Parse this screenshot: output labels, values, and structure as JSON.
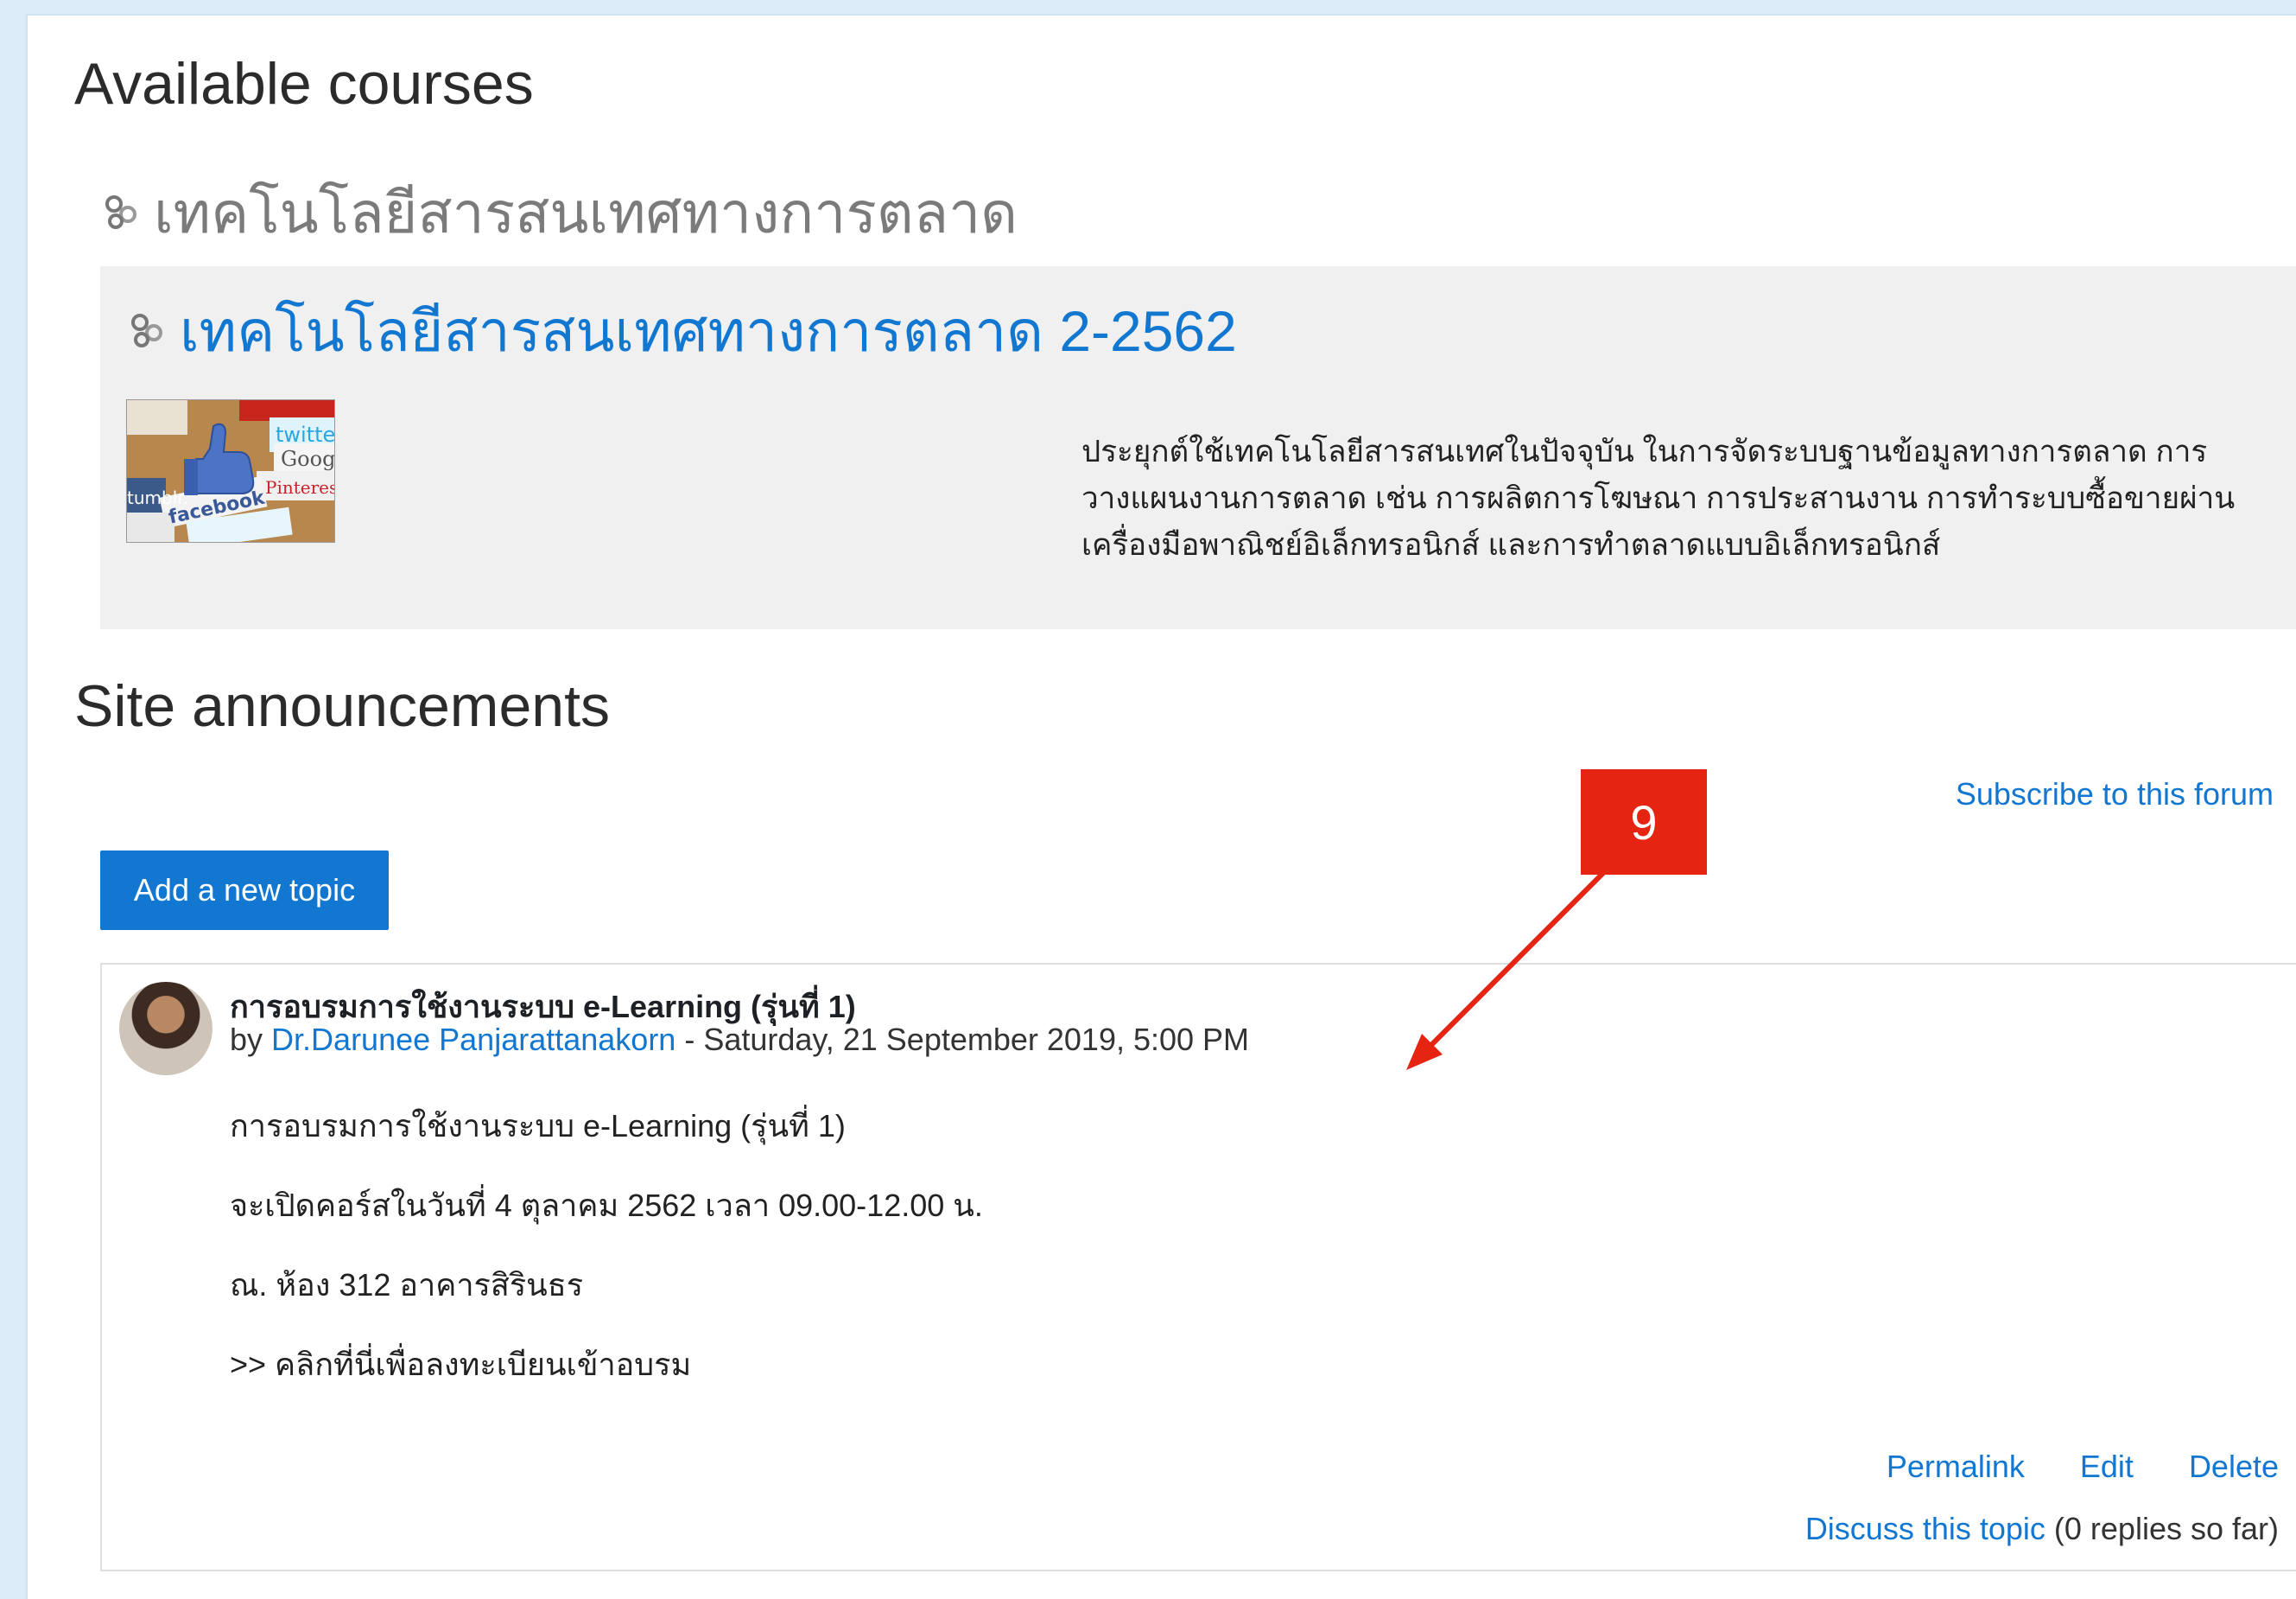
{
  "available_courses": {
    "heading": "Available courses",
    "category": "เทคโนโลยีสารสนเทศทางการตลาด",
    "course": {
      "title": "เทคโนโลยีสารสนเทศทางการตลาด 2-2562",
      "summary": "ประยุกต์ใช้เทคโนโลยีสารสนเทศในปัจจุบัน ในการจัดระบบฐานข้อมูลทางการตลาด การวางแผนงานการตลาด เช่น การผลิตการโฆษณา การประสานงาน การทำระบบซื้อขายผ่านเครื่องมือพาณิชย์อิเล็กทรอนิกส์ และการทำตลาดแบบอิเล็กทรอนิกส์",
      "image_words": [
        "Google",
        "twitter",
        "facebook",
        "Pinterest",
        "tumblr."
      ]
    }
  },
  "announcements": {
    "heading": "Site announcements",
    "subscribe_link": "Subscribe to this forum",
    "add_topic_button": "Add a new topic",
    "post": {
      "subject": "การอบรมการใช้งานระบบ e-Learning (รุ่นที่ 1)",
      "by": "by",
      "author": "Dr.Darunee Panjarattanakorn",
      "date": " - Saturday, 21 September 2019, 5:00 PM",
      "body": [
        "การอบรมการใช้งานระบบ e-Learning (รุ่นที่ 1)",
        "จะเปิดคอร์สในวันที่ 4 ตุลาคม 2562 เวลา 09.00-12.00 น.",
        "ณ. ห้อง 312 อาคารสิรินธร",
        ">> คลิกที่นี่เพื่อลงทะเบียนเข้าอบรม"
      ],
      "actions": {
        "permalink": "Permalink",
        "edit": "Edit",
        "delete": "Delete"
      },
      "discuss_link": "Discuss this topic",
      "replies": " (0 replies so far)"
    }
  },
  "annotation": {
    "label": "9",
    "color": "#e52411"
  },
  "colors": {
    "link": "#1177d1",
    "button": "#1177d1",
    "course_bg": "#f0f0f0"
  },
  "icons": {
    "course_icon": "course-icon",
    "avatar": "user-avatar"
  }
}
